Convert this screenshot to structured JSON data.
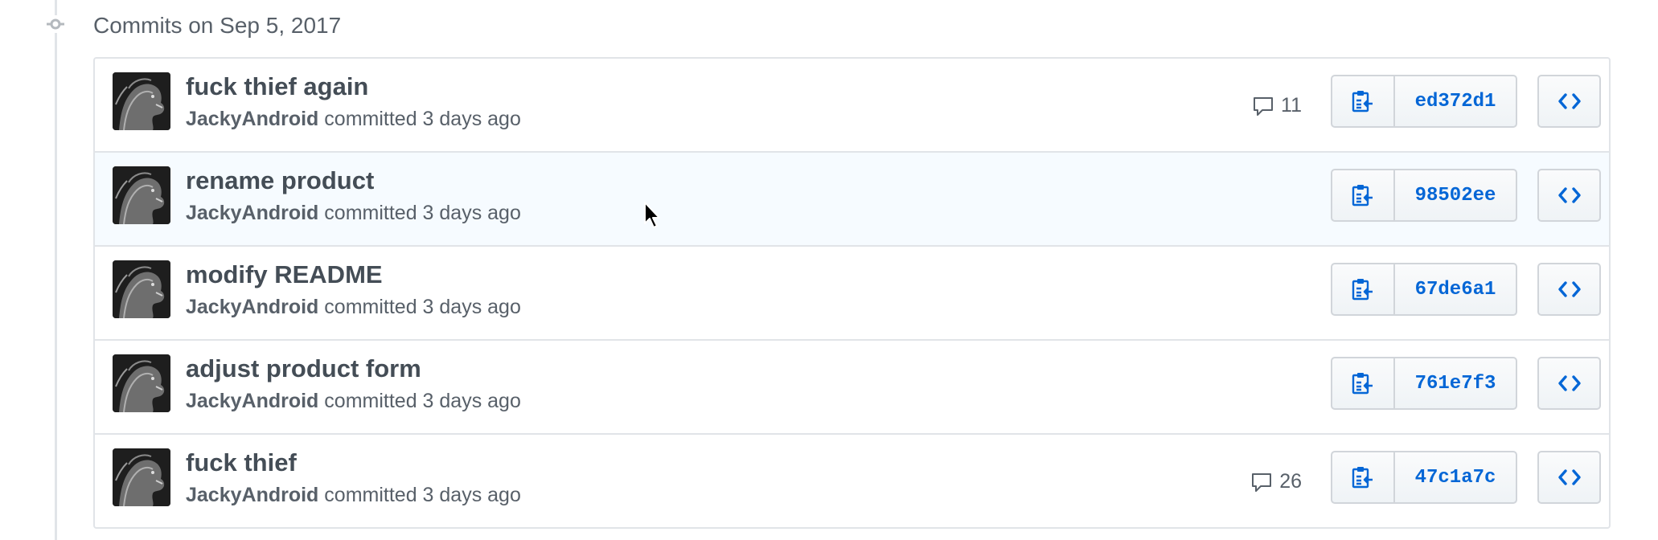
{
  "group": {
    "title": "Commits on Sep 5, 2017"
  },
  "commits": [
    {
      "title": "fuck thief again",
      "author": "JackyAndroid",
      "action": "committed 3 days ago",
      "comment_count": "11",
      "sha": "ed372d1",
      "hovered": false
    },
    {
      "title": "rename product",
      "author": "JackyAndroid",
      "action": "committed 3 days ago",
      "comment_count": "",
      "sha": "98502ee",
      "hovered": true
    },
    {
      "title": "modify README",
      "author": "JackyAndroid",
      "action": "committed 3 days ago",
      "comment_count": "",
      "sha": "67de6a1",
      "hovered": false
    },
    {
      "title": "adjust product form",
      "author": "JackyAndroid",
      "action": "committed 3 days ago",
      "comment_count": "",
      "sha": "761e7f3",
      "hovered": false
    },
    {
      "title": "fuck thief",
      "author": "JackyAndroid",
      "action": "committed 3 days ago",
      "comment_count": "26",
      "sha": "47c1a7c",
      "hovered": false
    }
  ],
  "icons": {
    "timeline": "git-commit-icon",
    "comment": "comment-icon",
    "copy": "clipboard-copy-icon",
    "browse": "code-icon",
    "cursor": "mouse-pointer-icon"
  },
  "colors": {
    "link": "#0366d6",
    "title": "#444d56",
    "meta": "#586069",
    "border": "#e1e4e8",
    "hover_row": "#f6fbff"
  }
}
